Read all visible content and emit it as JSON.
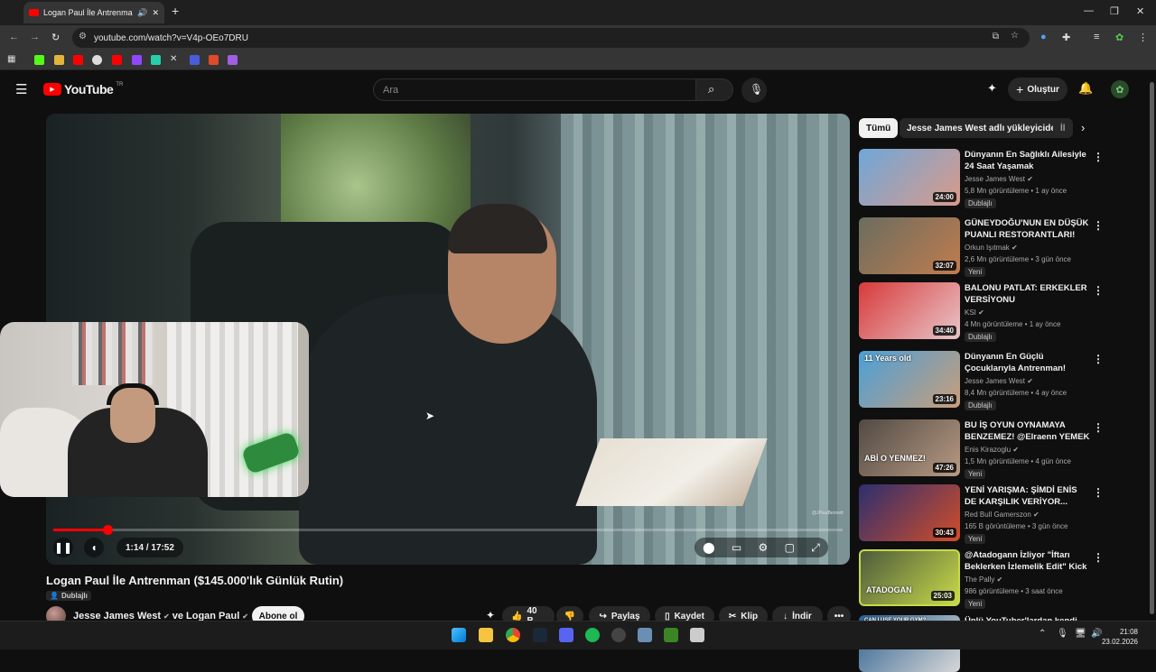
{
  "browser": {
    "tab_title": "Logan Paul İle Antrenman (",
    "url": "youtube.com/watch?v=V4p-OEo7DRU"
  },
  "youtube": {
    "logo_text": "YouTube",
    "region": "TR",
    "search_placeholder": "Ara",
    "create_label": "Oluştur"
  },
  "player": {
    "time": "1:14 / 17:52",
    "progress_fraction": 0.069,
    "watermark": "@JPaulBennett"
  },
  "video": {
    "title": "Logan Paul İle Antrenman ($145.000'lık Günlük Rutin)",
    "dub_badge": "Dublajlı",
    "channel": "Jesse James West",
    "channel_joiner": "ve",
    "channel2": "Logan Paul",
    "subscribe_label": "Abone ol",
    "likes": "40 B",
    "share_label": "Paylaş",
    "save_label": "Kaydet",
    "clip_label": "Klip",
    "download_label": "İndir"
  },
  "chips": [
    "Tümü",
    "Jesse James West adlı yükleyiciden",
    "İl"
  ],
  "recommendations": [
    {
      "title": "Dünyanın En Sağlıklı Ailesiyle 24 Saat Yaşamak",
      "channel": "Jesse James West",
      "meta": "5,8 Mn görüntüleme • 1 ay önce",
      "duration": "24:00",
      "badge": "Dublajlı",
      "colors": [
        "#6fa7d9",
        "#d99a8a"
      ]
    },
    {
      "title": "GÜNEYDOĞU'NUN EN DÜŞÜK PUANLI RESTORANTLARI!",
      "channel": "Orkun Işıtmak",
      "meta": "2,6 Mn görüntüleme • 3 gün önce",
      "duration": "32:07",
      "badge": "Yeni",
      "colors": [
        "#6b6d5f",
        "#c07c4e"
      ]
    },
    {
      "title": "BALONU PATLAT: ERKEKLER VERSİYONU",
      "channel": "KSI",
      "meta": "4 Mn görüntüleme • 1 ay önce",
      "duration": "34:40",
      "badge": "Dublajlı",
      "colors": [
        "#d83a3a",
        "#e8c6c9"
      ]
    },
    {
      "title": "Dünyanın En Güçlü Çocuklarıyla Antrenman!",
      "channel": "Jesse James West",
      "meta": "8,4 Mn görüntüleme • 4 ay önce",
      "duration": "23:16",
      "badge": "Dublajlı",
      "colors": [
        "#4aa0d8",
        "#c99d7a"
      ],
      "overlay": "11 Years old"
    },
    {
      "title": "BU İŞ OYUN OYNAMAYA BENZEMEZ! @Elraenn YEMEK ...",
      "channel": "Enis Kirazoglu",
      "meta": "1,5 Mn görüntüleme • 4 gün önce",
      "duration": "47:26",
      "badge": "Yeni",
      "colors": [
        "#514a43",
        "#b89a83"
      ],
      "overlay": "ABİ O YENMEZ!"
    },
    {
      "title": "YENİ YARIŞMA: ŞİMDİ ENİS DE KARŞILIK VERİYOR...",
      "channel": "Red Bull Gamerszon",
      "meta": "165 B görüntüleme • 3 gün önce",
      "duration": "30:43",
      "badge": "Yeni",
      "colors": [
        "#2c2f6f",
        "#d24d2a"
      ]
    },
    {
      "title": "@Atadogann İzliyor \"İftarı Beklerken İzlemelik Edit\" Kick ...",
      "channel": "The Pally",
      "meta": "986 görüntüleme • 3 saat önce",
      "duration": "25:03",
      "badge": "Yeni",
      "colors": [
        "#4d5b3c",
        "#c8d94a"
      ],
      "overlay": "ATADOGAN"
    },
    {
      "title": "Ünlü YouTuber'lardan kendi ey...",
      "channel": "",
      "meta": "",
      "duration": "",
      "badge": "",
      "colors": [
        "#2a5f8f",
        "#d8d8d8"
      ],
      "overlay": "CAN I USE YOUR GYM?"
    }
  ],
  "taskbar": {
    "time": "21:08",
    "date": "23.02.2026"
  }
}
